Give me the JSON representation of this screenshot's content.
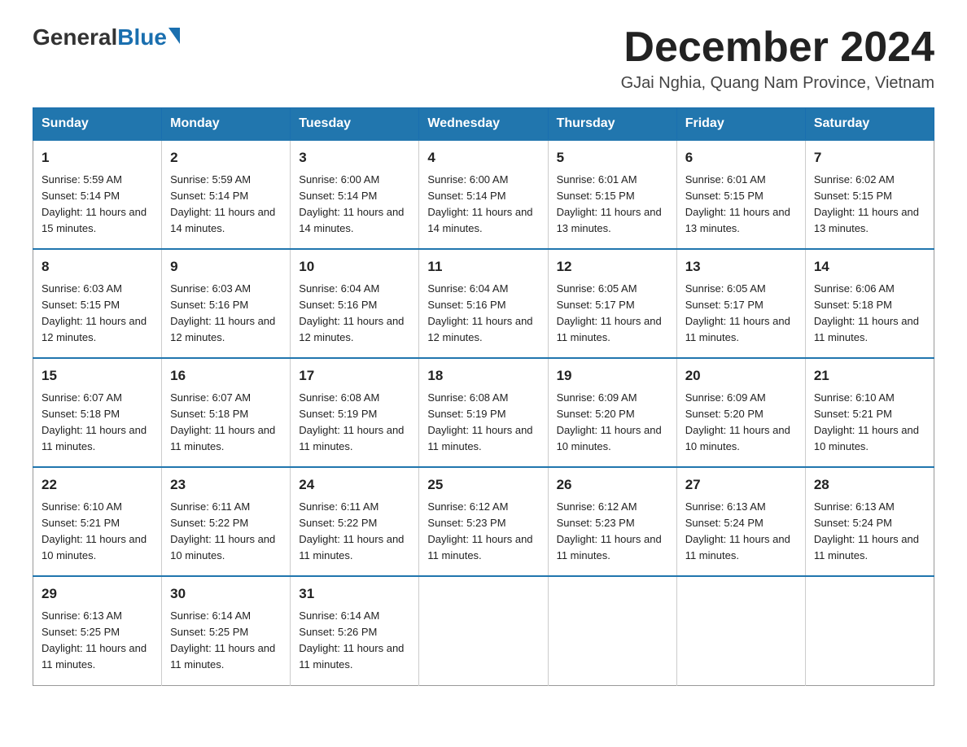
{
  "logo": {
    "general": "General",
    "blue": "Blue"
  },
  "title": {
    "month": "December 2024",
    "location": "GJai Nghia, Quang Nam Province, Vietnam"
  },
  "headers": [
    "Sunday",
    "Monday",
    "Tuesday",
    "Wednesday",
    "Thursday",
    "Friday",
    "Saturday"
  ],
  "weeks": [
    [
      {
        "day": "1",
        "sunrise": "5:59 AM",
        "sunset": "5:14 PM",
        "daylight": "11 hours and 15 minutes."
      },
      {
        "day": "2",
        "sunrise": "5:59 AM",
        "sunset": "5:14 PM",
        "daylight": "11 hours and 14 minutes."
      },
      {
        "day": "3",
        "sunrise": "6:00 AM",
        "sunset": "5:14 PM",
        "daylight": "11 hours and 14 minutes."
      },
      {
        "day": "4",
        "sunrise": "6:00 AM",
        "sunset": "5:14 PM",
        "daylight": "11 hours and 14 minutes."
      },
      {
        "day": "5",
        "sunrise": "6:01 AM",
        "sunset": "5:15 PM",
        "daylight": "11 hours and 13 minutes."
      },
      {
        "day": "6",
        "sunrise": "6:01 AM",
        "sunset": "5:15 PM",
        "daylight": "11 hours and 13 minutes."
      },
      {
        "day": "7",
        "sunrise": "6:02 AM",
        "sunset": "5:15 PM",
        "daylight": "11 hours and 13 minutes."
      }
    ],
    [
      {
        "day": "8",
        "sunrise": "6:03 AM",
        "sunset": "5:15 PM",
        "daylight": "11 hours and 12 minutes."
      },
      {
        "day": "9",
        "sunrise": "6:03 AM",
        "sunset": "5:16 PM",
        "daylight": "11 hours and 12 minutes."
      },
      {
        "day": "10",
        "sunrise": "6:04 AM",
        "sunset": "5:16 PM",
        "daylight": "11 hours and 12 minutes."
      },
      {
        "day": "11",
        "sunrise": "6:04 AM",
        "sunset": "5:16 PM",
        "daylight": "11 hours and 12 minutes."
      },
      {
        "day": "12",
        "sunrise": "6:05 AM",
        "sunset": "5:17 PM",
        "daylight": "11 hours and 11 minutes."
      },
      {
        "day": "13",
        "sunrise": "6:05 AM",
        "sunset": "5:17 PM",
        "daylight": "11 hours and 11 minutes."
      },
      {
        "day": "14",
        "sunrise": "6:06 AM",
        "sunset": "5:18 PM",
        "daylight": "11 hours and 11 minutes."
      }
    ],
    [
      {
        "day": "15",
        "sunrise": "6:07 AM",
        "sunset": "5:18 PM",
        "daylight": "11 hours and 11 minutes."
      },
      {
        "day": "16",
        "sunrise": "6:07 AM",
        "sunset": "5:18 PM",
        "daylight": "11 hours and 11 minutes."
      },
      {
        "day": "17",
        "sunrise": "6:08 AM",
        "sunset": "5:19 PM",
        "daylight": "11 hours and 11 minutes."
      },
      {
        "day": "18",
        "sunrise": "6:08 AM",
        "sunset": "5:19 PM",
        "daylight": "11 hours and 11 minutes."
      },
      {
        "day": "19",
        "sunrise": "6:09 AM",
        "sunset": "5:20 PM",
        "daylight": "11 hours and 10 minutes."
      },
      {
        "day": "20",
        "sunrise": "6:09 AM",
        "sunset": "5:20 PM",
        "daylight": "11 hours and 10 minutes."
      },
      {
        "day": "21",
        "sunrise": "6:10 AM",
        "sunset": "5:21 PM",
        "daylight": "11 hours and 10 minutes."
      }
    ],
    [
      {
        "day": "22",
        "sunrise": "6:10 AM",
        "sunset": "5:21 PM",
        "daylight": "11 hours and 10 minutes."
      },
      {
        "day": "23",
        "sunrise": "6:11 AM",
        "sunset": "5:22 PM",
        "daylight": "11 hours and 10 minutes."
      },
      {
        "day": "24",
        "sunrise": "6:11 AM",
        "sunset": "5:22 PM",
        "daylight": "11 hours and 11 minutes."
      },
      {
        "day": "25",
        "sunrise": "6:12 AM",
        "sunset": "5:23 PM",
        "daylight": "11 hours and 11 minutes."
      },
      {
        "day": "26",
        "sunrise": "6:12 AM",
        "sunset": "5:23 PM",
        "daylight": "11 hours and 11 minutes."
      },
      {
        "day": "27",
        "sunrise": "6:13 AM",
        "sunset": "5:24 PM",
        "daylight": "11 hours and 11 minutes."
      },
      {
        "day": "28",
        "sunrise": "6:13 AM",
        "sunset": "5:24 PM",
        "daylight": "11 hours and 11 minutes."
      }
    ],
    [
      {
        "day": "29",
        "sunrise": "6:13 AM",
        "sunset": "5:25 PM",
        "daylight": "11 hours and 11 minutes."
      },
      {
        "day": "30",
        "sunrise": "6:14 AM",
        "sunset": "5:25 PM",
        "daylight": "11 hours and 11 minutes."
      },
      {
        "day": "31",
        "sunrise": "6:14 AM",
        "sunset": "5:26 PM",
        "daylight": "11 hours and 11 minutes."
      },
      null,
      null,
      null,
      null
    ]
  ],
  "labels": {
    "sunrise": "Sunrise: ",
    "sunset": "Sunset: ",
    "daylight": "Daylight: "
  }
}
